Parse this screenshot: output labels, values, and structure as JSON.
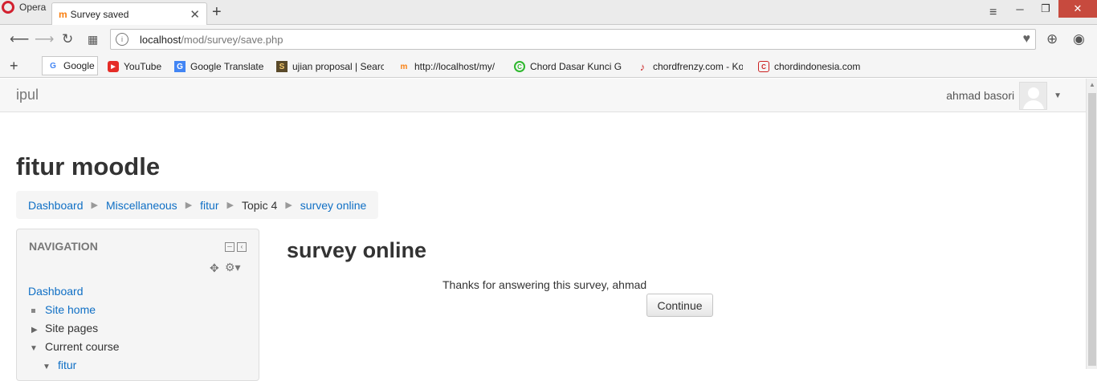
{
  "browser": {
    "app_label": "Opera",
    "tab": {
      "title": "Survey saved",
      "favicon": "m"
    },
    "address": {
      "host": "localhost",
      "path": "/mod/survey/save.php"
    },
    "bookmarks": [
      {
        "label": "Google",
        "icon": "google-icon"
      },
      {
        "label": "YouTube",
        "icon": "youtube-icon"
      },
      {
        "label": "Google Translate",
        "icon": "translate-icon"
      },
      {
        "label": "ujian proposal | Searc",
        "icon": "bookmark-icon"
      },
      {
        "label": "http://localhost/my/",
        "icon": "moodle-icon"
      },
      {
        "label": "Chord Dasar Kunci Gi",
        "icon": "chord-icon"
      },
      {
        "label": "chordfrenzy.com - Ko",
        "icon": "guitar-icon"
      },
      {
        "label": "chordindonesia.com",
        "icon": "chord-indonesia-icon"
      }
    ],
    "colors": {
      "window_close": "#c74a3e",
      "opera_red": "#d2202f"
    }
  },
  "site": {
    "brand": "ipul",
    "user_name": "ahmad basori"
  },
  "page": {
    "heading": "fitur moodle",
    "breadcrumb": [
      "Dashboard",
      "Miscellaneous",
      "fitur",
      "Topic 4",
      "survey online"
    ],
    "main_title": "survey online",
    "message": "Thanks for answering this survey, ahmad",
    "continue_label": "Continue"
  },
  "navigation": {
    "title": "NAVIGATION",
    "items": [
      "Dashboard",
      "Site home",
      "Site pages",
      "Current course",
      "fitur"
    ]
  },
  "colors": {
    "link": "#0f6fc5",
    "text": "#333333"
  }
}
